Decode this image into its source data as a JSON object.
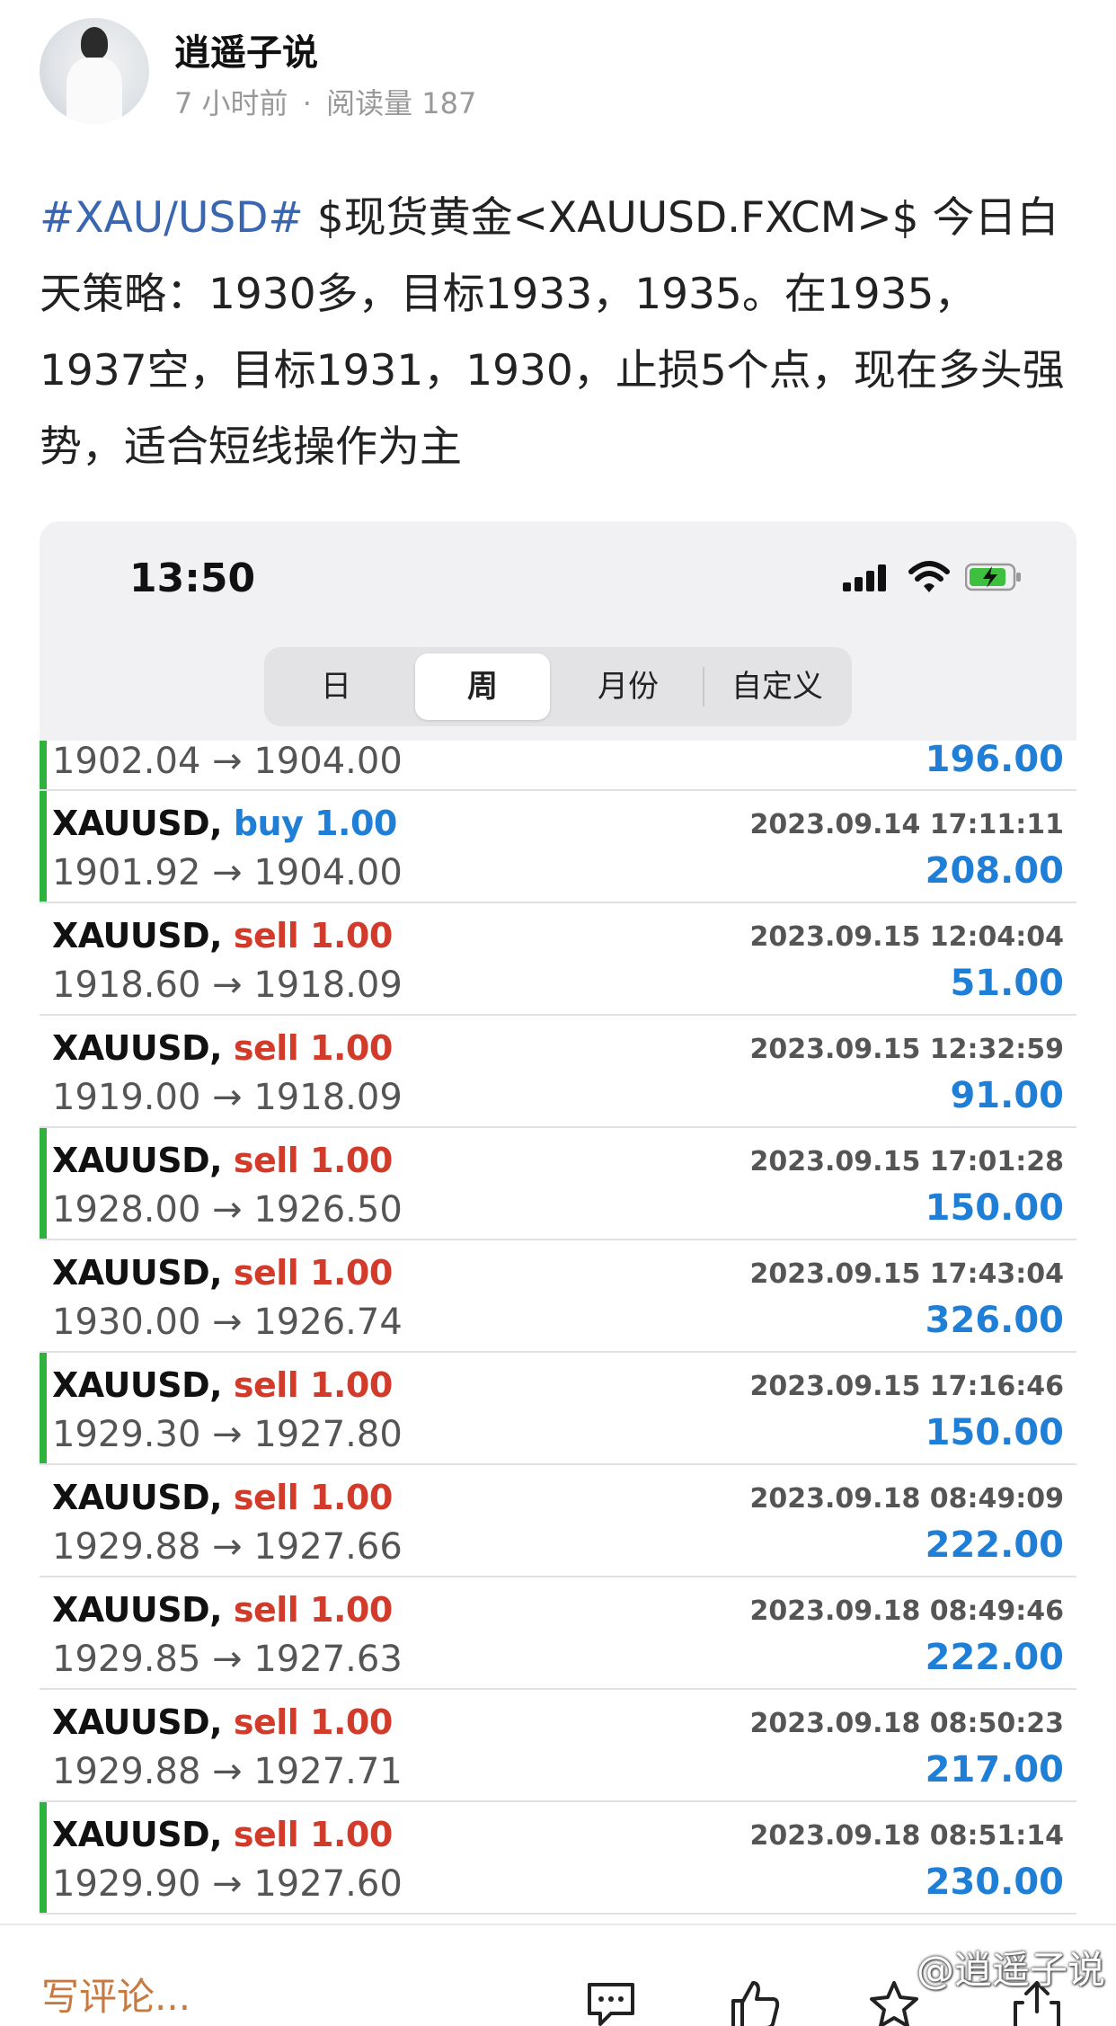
{
  "author": {
    "name": "逍遥子说",
    "time_ago": "7 小时前",
    "separator": "·",
    "reads_label": "阅读量",
    "reads_count": "187"
  },
  "post": {
    "hashtag": "#XAU/USD#",
    "text": " $现货黄金<XAUUSD.FXCM>$ 今日白天策略：1930多，目标1933，1935。在1935，1937空，目标1931，1930，止损5个点，现在多头强势，适合短线操作为主"
  },
  "screenshot": {
    "clock": "13:50",
    "segments": [
      "日",
      "周",
      "月份",
      "自定义"
    ],
    "active_segment": "周",
    "partial_row": {
      "prices": "1902.04 → 1904.00",
      "profit": "196.00",
      "marker": true
    },
    "trades": [
      {
        "symbol": "XAUUSD,",
        "side": "buy",
        "volume": "1.00",
        "time": "2023.09.14 17:11:11",
        "prices": "1901.92 → 1904.00",
        "profit": "208.00",
        "marker": true
      },
      {
        "symbol": "XAUUSD,",
        "side": "sell",
        "volume": "1.00",
        "time": "2023.09.15 12:04:04",
        "prices": "1918.60 → 1918.09",
        "profit": "51.00",
        "marker": false
      },
      {
        "symbol": "XAUUSD,",
        "side": "sell",
        "volume": "1.00",
        "time": "2023.09.15 12:32:59",
        "prices": "1919.00 → 1918.09",
        "profit": "91.00",
        "marker": false
      },
      {
        "symbol": "XAUUSD,",
        "side": "sell",
        "volume": "1.00",
        "time": "2023.09.15 17:01:28",
        "prices": "1928.00 → 1926.50",
        "profit": "150.00",
        "marker": true
      },
      {
        "symbol": "XAUUSD,",
        "side": "sell",
        "volume": "1.00",
        "time": "2023.09.15 17:43:04",
        "prices": "1930.00 → 1926.74",
        "profit": "326.00",
        "marker": false
      },
      {
        "symbol": "XAUUSD,",
        "side": "sell",
        "volume": "1.00",
        "time": "2023.09.15 17:16:46",
        "prices": "1929.30 → 1927.80",
        "profit": "150.00",
        "marker": true
      },
      {
        "symbol": "XAUUSD,",
        "side": "sell",
        "volume": "1.00",
        "time": "2023.09.18 08:49:09",
        "prices": "1929.88 → 1927.66",
        "profit": "222.00",
        "marker": false
      },
      {
        "symbol": "XAUUSD,",
        "side": "sell",
        "volume": "1.00",
        "time": "2023.09.18 08:49:46",
        "prices": "1929.85 → 1927.63",
        "profit": "222.00",
        "marker": false
      },
      {
        "symbol": "XAUUSD,",
        "side": "sell",
        "volume": "1.00",
        "time": "2023.09.18 08:50:23",
        "prices": "1929.88 → 1927.71",
        "profit": "217.00",
        "marker": false
      },
      {
        "symbol": "XAUUSD,",
        "side": "sell",
        "volume": "1.00",
        "time": "2023.09.18 08:51:14",
        "prices": "1929.90 → 1927.60",
        "profit": "230.00",
        "marker": true
      }
    ]
  },
  "bottom_bar": {
    "comment_placeholder": "写评论...",
    "icons": [
      "comment-icon",
      "like-icon",
      "star-icon",
      "share-icon"
    ],
    "watermark": "@逍遥子说"
  },
  "colors": {
    "hashtag": "#3a66b0",
    "buy": "#1f7fd6",
    "sell": "#d23a2a",
    "profit": "#1f7fd6",
    "marker": "#2eb33f",
    "comment": "#c8793f"
  }
}
